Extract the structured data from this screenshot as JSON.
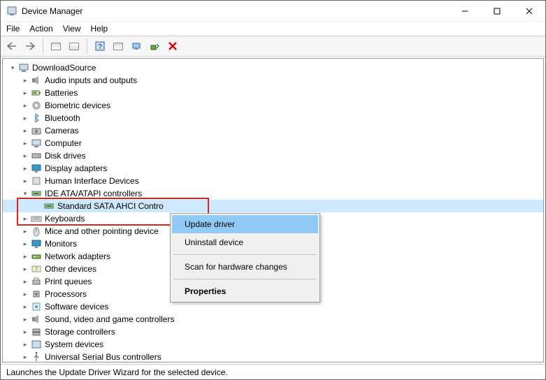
{
  "window": {
    "title": "Device Manager"
  },
  "menu": {
    "file": "File",
    "action": "Action",
    "view": "View",
    "help": "Help"
  },
  "tree": {
    "root": "DownloadSource",
    "items": [
      "Audio inputs and outputs",
      "Batteries",
      "Biometric devices",
      "Bluetooth",
      "Cameras",
      "Computer",
      "Disk drives",
      "Display adapters",
      "Human Interface Devices",
      "IDE ATA/ATAPI controllers",
      "Keyboards",
      "Mice and other pointing device",
      "Monitors",
      "Network adapters",
      "Other devices",
      "Print queues",
      "Processors",
      "Software devices",
      "Sound, video and game controllers",
      "Storage controllers",
      "System devices",
      "Universal Serial Bus controllers"
    ],
    "ide_child": "Standard SATA AHCI Contro"
  },
  "context_menu": {
    "update": "Update driver",
    "uninstall": "Uninstall device",
    "scan": "Scan for hardware changes",
    "properties": "Properties"
  },
  "status": "Launches the Update Driver Wizard for the selected device."
}
